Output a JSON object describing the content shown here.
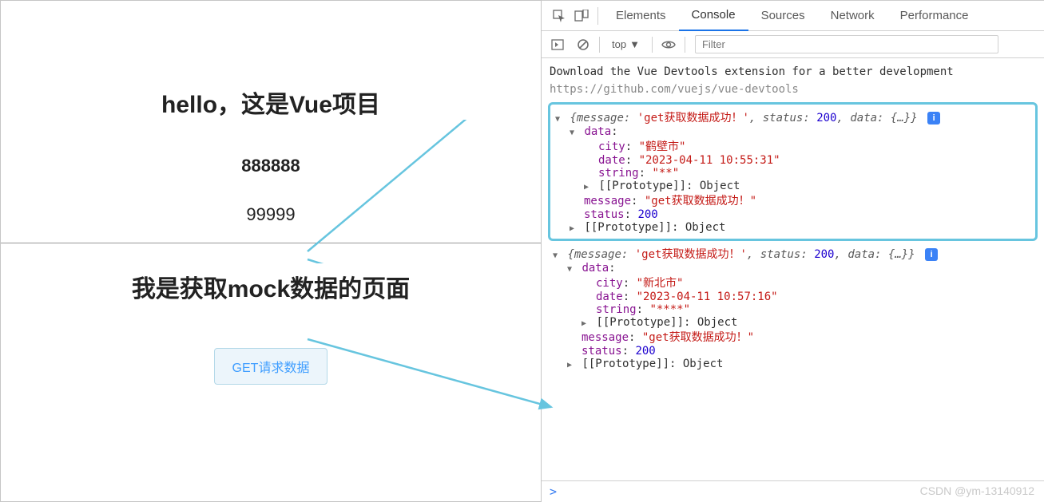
{
  "page": {
    "title": "hello，这是Vue项目",
    "num1": "888888",
    "num2": "99999",
    "mock_title": "我是获取mock数据的页面",
    "get_button": "GET请求数据"
  },
  "devtools": {
    "tabs": {
      "elements": "Elements",
      "console": "Console",
      "sources": "Sources",
      "network": "Network",
      "performance": "Performance"
    },
    "toolbar": {
      "context": "top",
      "filter_placeholder": "Filter"
    }
  },
  "console": {
    "banner_line1": "Download the Vue Devtools extension for a better development",
    "banner_line2": "https://github.com/vuejs/vue-devtools",
    "entries": [
      {
        "summary_message": "'get获取数据成功！'",
        "summary_status": "200",
        "summary_data": "{…}",
        "data": {
          "city": "\"鹤壁市\"",
          "date": "\"2023-04-11 10:55:31\"",
          "string": "\"**\""
        },
        "proto": "[[Prototype]]",
        "proto_val": "Object",
        "message": "\"get获取数据成功！\"",
        "status": "200"
      },
      {
        "summary_message": "'get获取数据成功！'",
        "summary_status": "200",
        "summary_data": "{…}",
        "data": {
          "city": "\"新北市\"",
          "date": "\"2023-04-11 10:57:16\"",
          "string": "\"****\""
        },
        "proto": "[[Prototype]]",
        "proto_val": "Object",
        "message": "\"get获取数据成功！\"",
        "status": "200"
      }
    ],
    "prompt": ">"
  },
  "labels": {
    "data": "data",
    "city": "city",
    "date": "date",
    "string": "string",
    "message_k": "message",
    "status_k": "status",
    "info_badge": "i"
  },
  "watermark": "CSDN @ym-13140912"
}
